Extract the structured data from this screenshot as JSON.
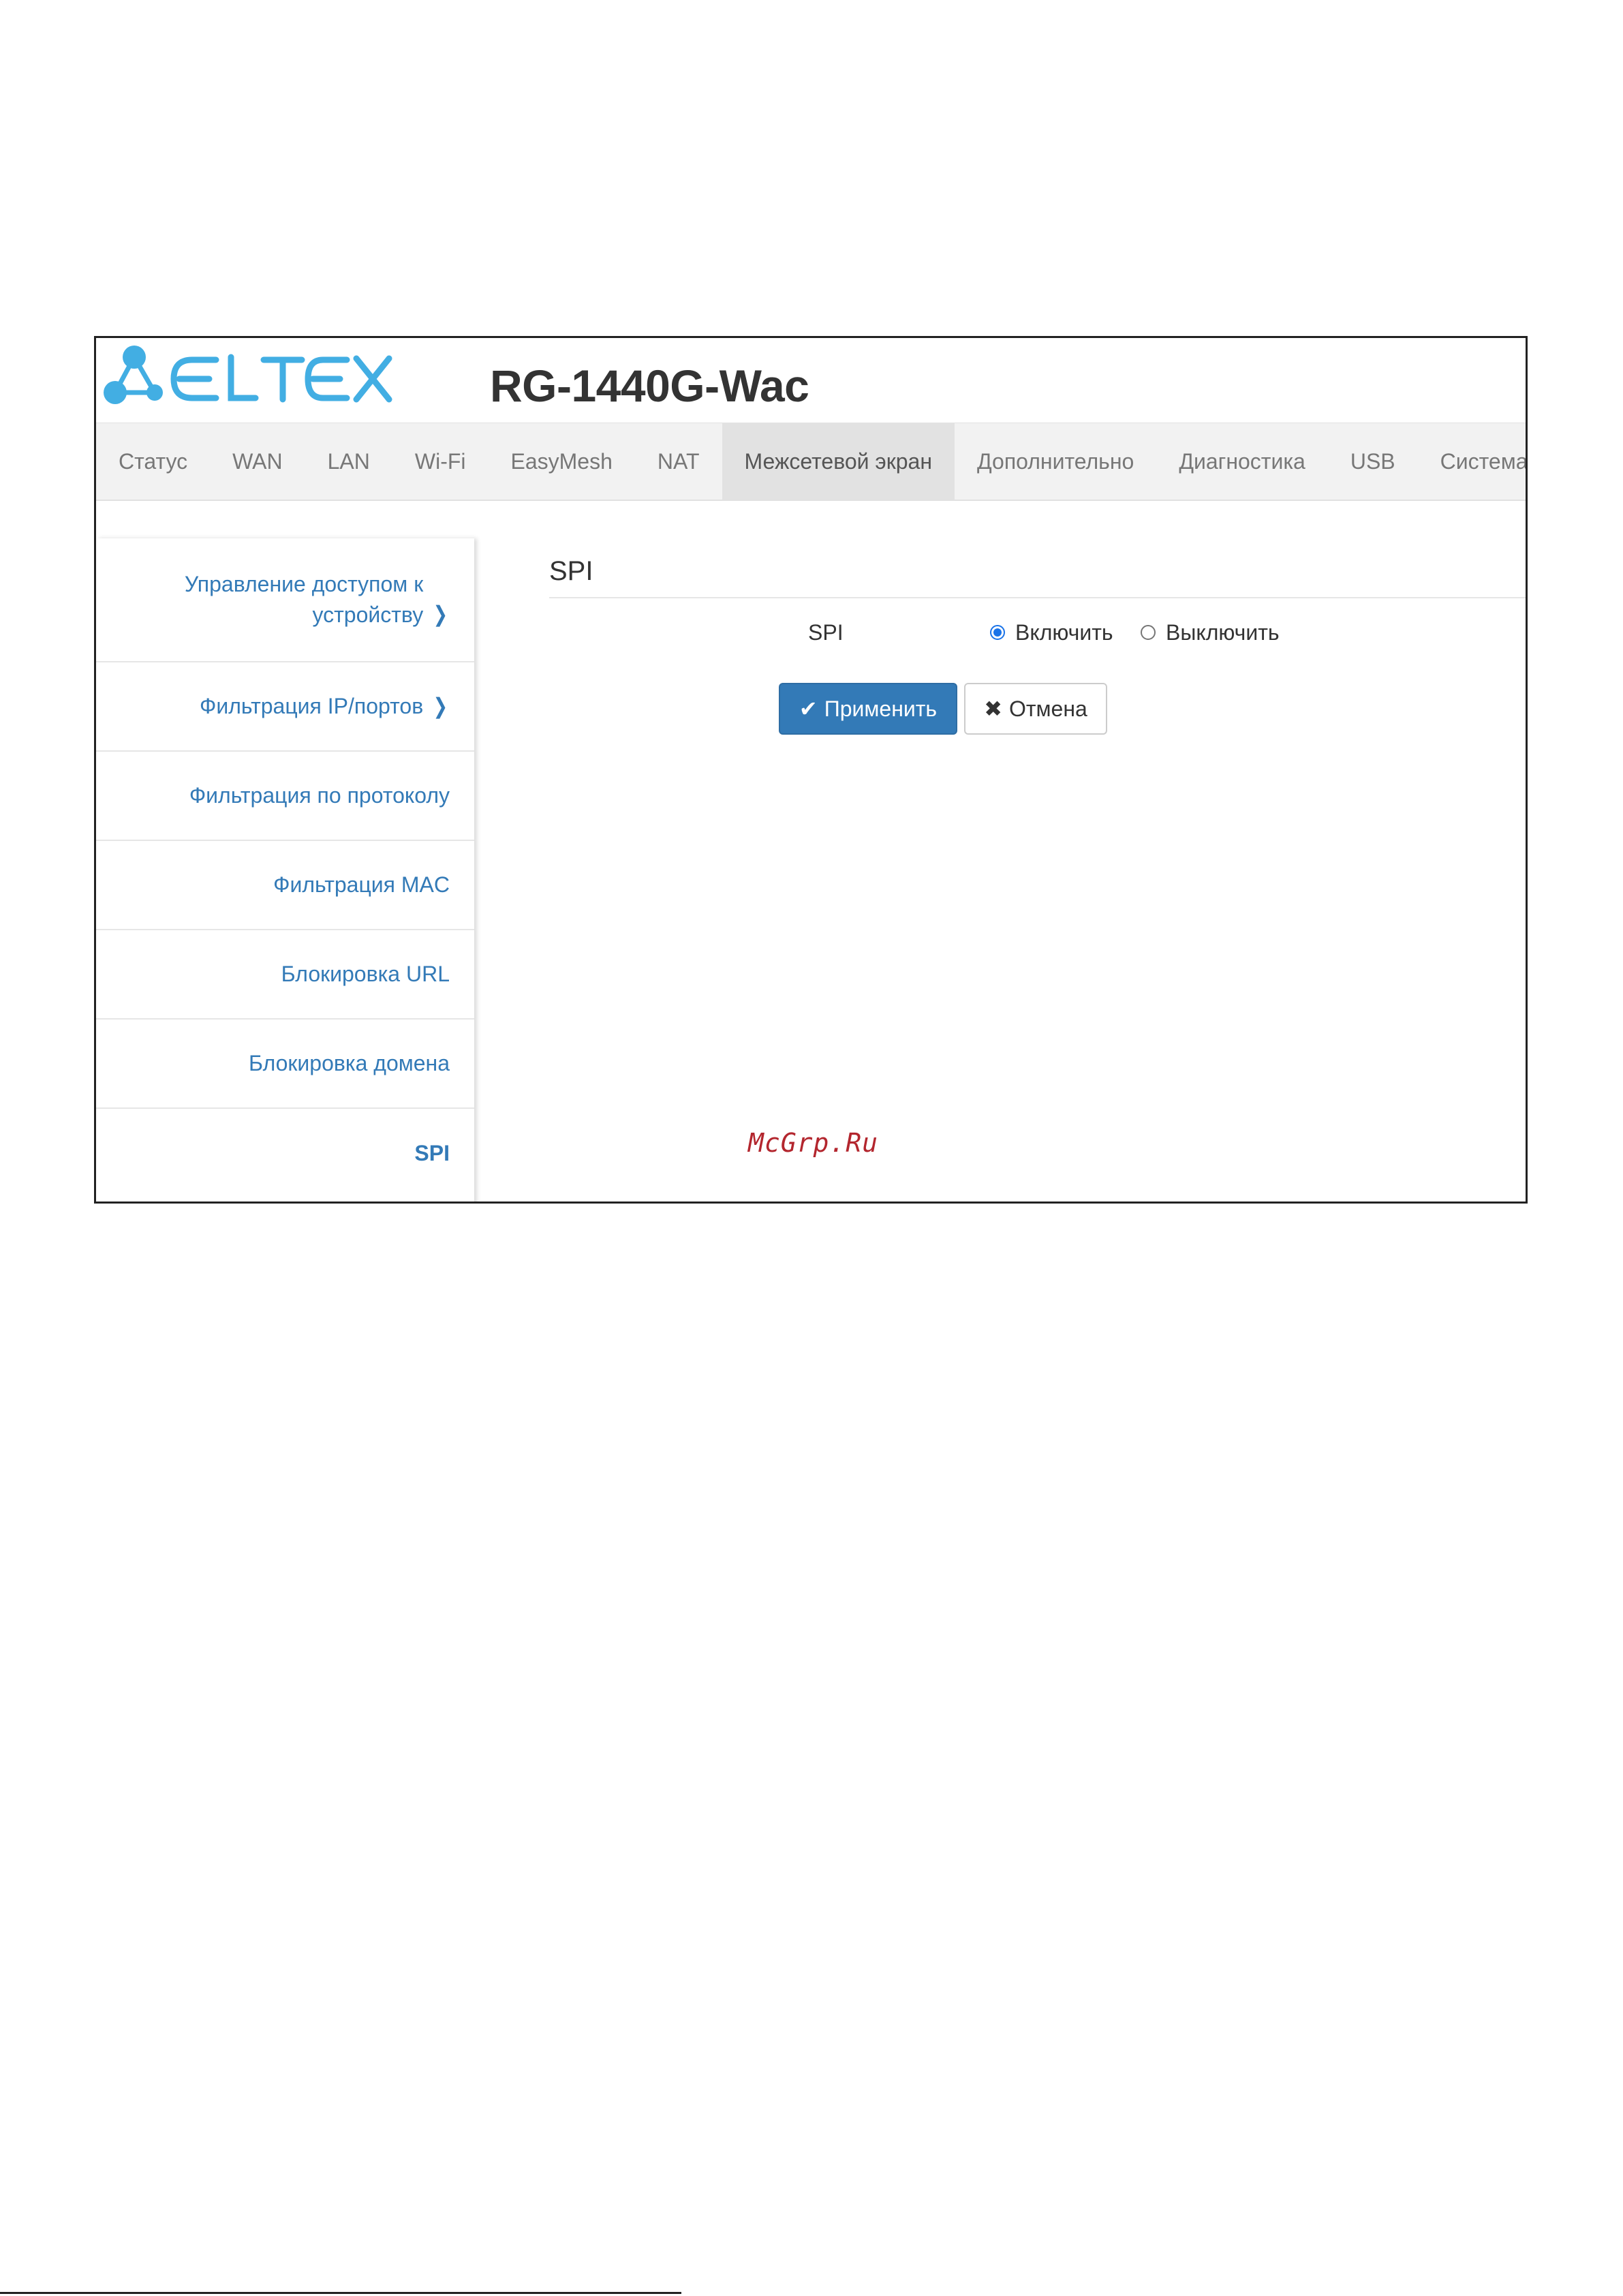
{
  "header": {
    "logo_text": "ELTEX",
    "device_title": "RG-1440G-Wac",
    "logo_color": "#42aee3"
  },
  "nav": {
    "items": [
      {
        "label": "Статус"
      },
      {
        "label": "WAN"
      },
      {
        "label": "LAN"
      },
      {
        "label": "Wi-Fi"
      },
      {
        "label": "EasyMesh"
      },
      {
        "label": "NAT"
      },
      {
        "label": "Межсетевой экран",
        "active": true
      },
      {
        "label": "Дополнительно"
      },
      {
        "label": "Диагностика"
      },
      {
        "label": "USB"
      },
      {
        "label": "Система"
      }
    ]
  },
  "sidebar": {
    "items": [
      {
        "label": "Управление доступом к устройству",
        "has_submenu": true
      },
      {
        "label": "Фильтрация IP/портов",
        "has_submenu": true
      },
      {
        "label": "Фильтрация по протоколу"
      },
      {
        "label": "Фильтрация MAC"
      },
      {
        "label": "Блокировка URL"
      },
      {
        "label": "Блокировка домена"
      },
      {
        "label": "SPI",
        "active": true
      }
    ]
  },
  "main": {
    "section_title": "SPI",
    "spi_label": "SPI",
    "options": [
      {
        "label": "Включить",
        "selected": true
      },
      {
        "label": "Выключить",
        "selected": false
      }
    ],
    "apply_label": "Применить",
    "cancel_label": "Отмена",
    "primary_color": "#337ab7"
  },
  "watermark": "McGrp.Ru"
}
